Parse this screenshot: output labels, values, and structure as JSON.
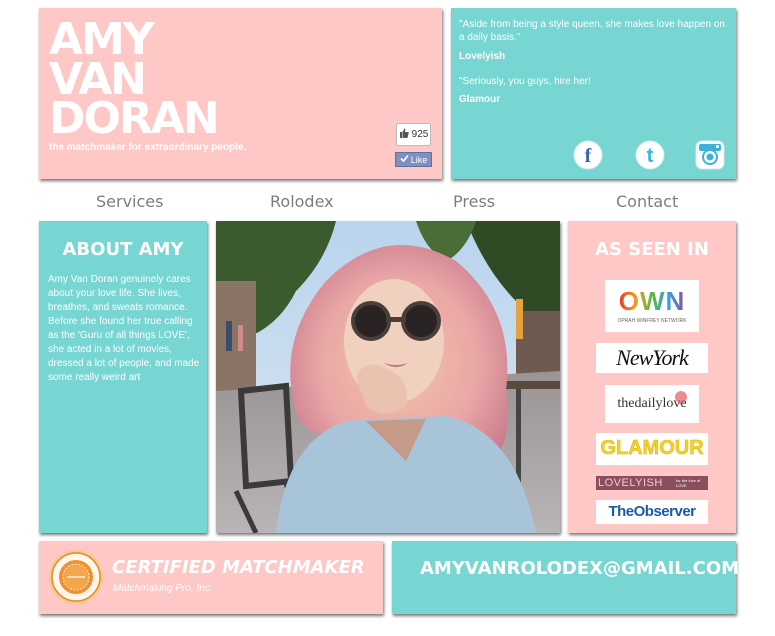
{
  "header": {
    "name_line1": "AMY",
    "name_line2": "VAN",
    "name_line3": "DORAN",
    "tagline": "the matchmaker for extraordinary people.",
    "like_count": "925",
    "like_label": "Like"
  },
  "quotes": [
    {
      "text": "\"Aside from being a style queen, she makes love happen on a daily basis.\"",
      "source": "Lovelyish"
    },
    {
      "text": "\"Seriously, you guys, hire her!",
      "source": "Glamour"
    }
  ],
  "social": {
    "icons": [
      "facebook-icon",
      "twitter-icon",
      "instagram-icon"
    ],
    "facebook_letter": "f",
    "twitter_letter": "t"
  },
  "nav": {
    "items": [
      "Services",
      "Rolodex",
      "Press",
      "Contact"
    ]
  },
  "about": {
    "title": "ABOUT AMY",
    "text": "Amy Van Doran genuinely cares about your love life. She lives, breathes, and sweats romance. Before she found her true calling as the 'Guru of all things LOVE', she acted in a lot of movies, dressed a lot of people, and made some really weird art"
  },
  "seen_in": {
    "title": "AS SEEN IN",
    "logos": [
      {
        "name": "OWN",
        "sub": "OPRAH WINFREY NETWORK"
      },
      {
        "name": "NewYork"
      },
      {
        "name": "thedailylove"
      },
      {
        "name": "GLAMOUR"
      },
      {
        "name": "LOVELYISH",
        "sub": "for the love of LOVE"
      },
      {
        "name": "TheObserver"
      }
    ]
  },
  "certification": {
    "title": "CERTIFIED MATCHMAKER",
    "org": "Matchmaking Pro, Inc.",
    "seal_text": "Certified Matchmaker"
  },
  "contact": {
    "email": "AMYVANROLODEX@GMAIL.COM"
  },
  "colors": {
    "pink": "#fec8c7",
    "teal": "#77d6d2",
    "nav_text": "#7d7d7d"
  }
}
